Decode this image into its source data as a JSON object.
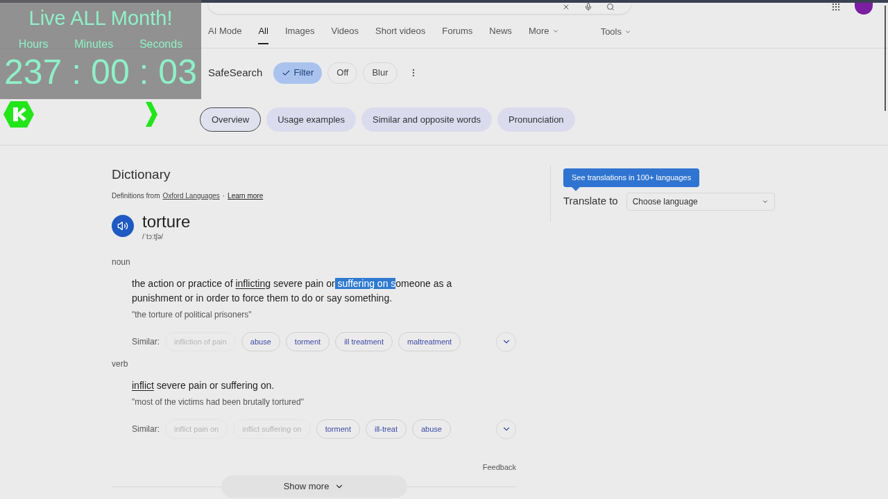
{
  "overlay": {
    "banner": "Live ALL Month!",
    "units": [
      "Hours",
      "Minutes",
      "Seconds"
    ],
    "timer": "237 : 00 : 03"
  },
  "nav_tabs": [
    {
      "label": "AI Mode",
      "selected": false,
      "kind": "tab"
    },
    {
      "label": "All",
      "selected": true,
      "kind": "tab"
    },
    {
      "label": "Images",
      "selected": false,
      "kind": "tab"
    },
    {
      "label": "Videos",
      "selected": false,
      "kind": "tab"
    },
    {
      "label": "Short videos",
      "selected": false,
      "kind": "tab"
    },
    {
      "label": "Forums",
      "selected": false,
      "kind": "tab"
    },
    {
      "label": "News",
      "selected": false,
      "kind": "tab"
    },
    {
      "label": "More",
      "selected": false,
      "kind": "menu"
    }
  ],
  "tools": "Tools",
  "safesearch": {
    "label": "SafeSearch",
    "options": [
      {
        "label": "Filter",
        "selected": true
      },
      {
        "label": "Off",
        "selected": false
      },
      {
        "label": "Blur",
        "selected": false
      }
    ]
  },
  "chips": [
    {
      "label": "Overview",
      "selected": true
    },
    {
      "label": "Usage examples",
      "selected": false
    },
    {
      "label": "Similar and opposite words",
      "selected": false
    },
    {
      "label": "Pronunciation",
      "selected": false
    }
  ],
  "dictionary": {
    "title": "Dictionary",
    "source_prefix": "Definitions from",
    "source_link": "Oxford Languages",
    "separator": "·",
    "learn_more": "Learn more",
    "word": "torture",
    "phonetic": "/ˈtɔːtʃə/",
    "senses": [
      {
        "pos": "noun",
        "definition": {
          "link": "inflicting",
          "before": "the action or practice of",
          "after_before_sel": "severe pain or",
          "selected": "suffering on s",
          "after": "omeone as a punishment or in order to force them to do or say something."
        },
        "example": "\"the torture of political prisoners\"",
        "similar_label": "Similar:",
        "similar": [
          {
            "label": "infliction of pain",
            "disabled": true
          },
          {
            "label": "abuse",
            "disabled": false
          },
          {
            "label": "torment",
            "disabled": false
          },
          {
            "label": "ill treatment",
            "disabled": false
          },
          {
            "label": "maltreatment",
            "disabled": false
          }
        ]
      },
      {
        "pos": "verb",
        "definition": {
          "link": "inflict",
          "after_before_sel": "severe pain or suffering on."
        },
        "example": "\"most of the victims had been brutally tortured\"",
        "similar_label": "Similar:",
        "similar": [
          {
            "label": "inflict pain on",
            "disabled": true
          },
          {
            "label": "inflict suffering on",
            "disabled": true
          },
          {
            "label": "torment",
            "disabled": false
          },
          {
            "label": "ill-treat",
            "disabled": false
          },
          {
            "label": "abuse",
            "disabled": false
          }
        ]
      }
    ],
    "feedback": "Feedback",
    "show_more": "Show more"
  },
  "translate": {
    "tooltip": "See translations in 100+ languages",
    "label": "Translate to",
    "placeholder": "Choose language"
  }
}
